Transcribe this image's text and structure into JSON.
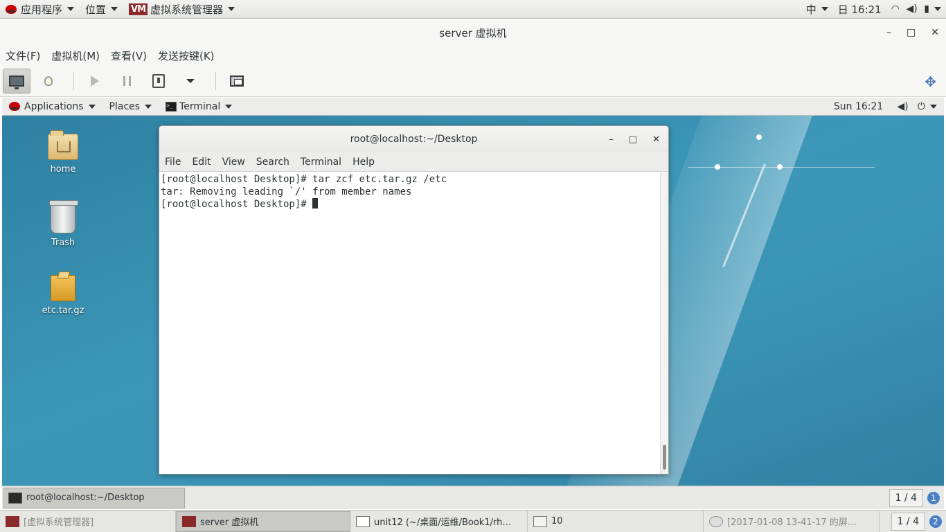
{
  "host_topbar": {
    "applications": "应用程序",
    "places": "位置",
    "app_logo": "VM",
    "app_name": "虚拟系统管理器",
    "input_method": "中",
    "clock": "日 16:21"
  },
  "vm_window": {
    "title": "server 虚拟机",
    "controls": {
      "minimize": "–",
      "maximize": "□",
      "close": "✕"
    },
    "menu": [
      "文件(F)",
      "虚拟机(M)",
      "查看(V)",
      "发送按键(K)"
    ]
  },
  "guest_topbar": {
    "applications": "Applications",
    "places": "Places",
    "app_name": "Terminal",
    "clock": "Sun 16:21"
  },
  "desktop_icons": [
    {
      "label": "home",
      "icon": "home-folder-icon"
    },
    {
      "label": "Trash",
      "icon": "trash-icon"
    },
    {
      "label": "etc.tar.gz",
      "icon": "archive-icon"
    }
  ],
  "terminal": {
    "title": "root@localhost:~/Desktop",
    "menu": [
      "File",
      "Edit",
      "View",
      "Search",
      "Terminal",
      "Help"
    ],
    "lines": [
      "[root@localhost Desktop]# tar zcf etc.tar.gz /etc",
      "tar: Removing leading `/' from member names",
      "[root@localhost Desktop]# "
    ]
  },
  "guest_taskbar": {
    "task": "root@localhost:~/Desktop",
    "workspace": "1 / 4",
    "workspace_badge": "1"
  },
  "host_taskbar": {
    "tasks": [
      {
        "label": "[虚拟系统管理器]"
      },
      {
        "label": "server 虚拟机"
      },
      {
        "label": "unit12 (~/桌面/运维/Book1/rh…"
      },
      {
        "label": "10"
      },
      {
        "label": "[2017-01-08 13-41-17 的屏…"
      }
    ],
    "workspace": "1 / 4",
    "workspace_badge": "2"
  },
  "colors": {
    "desktop_blue": "#3a93b4",
    "redhat_red": "#cc0000",
    "workspace_badge": "#4a7fc1"
  }
}
